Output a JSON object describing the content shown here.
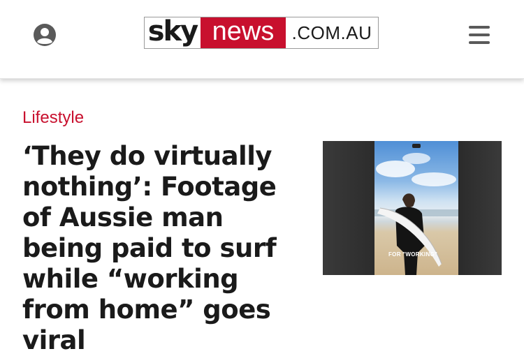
{
  "header": {
    "logo": {
      "sky": "sky",
      "news": "news",
      "domain": ".COM.AU"
    },
    "account_icon": "user-circle-icon",
    "menu_icon": "hamburger-menu-icon"
  },
  "article": {
    "category": "Lifestyle",
    "headline": "‘They do virtually nothing’: Footage of Aussie man being paid to surf while “working from home” goes viral",
    "thumbnail_caption": "FOR \"WORKING\""
  },
  "colors": {
    "brand_red": "#c8102e",
    "text_dark": "#1a1a1a",
    "icon_grey": "#5a5a5a"
  }
}
